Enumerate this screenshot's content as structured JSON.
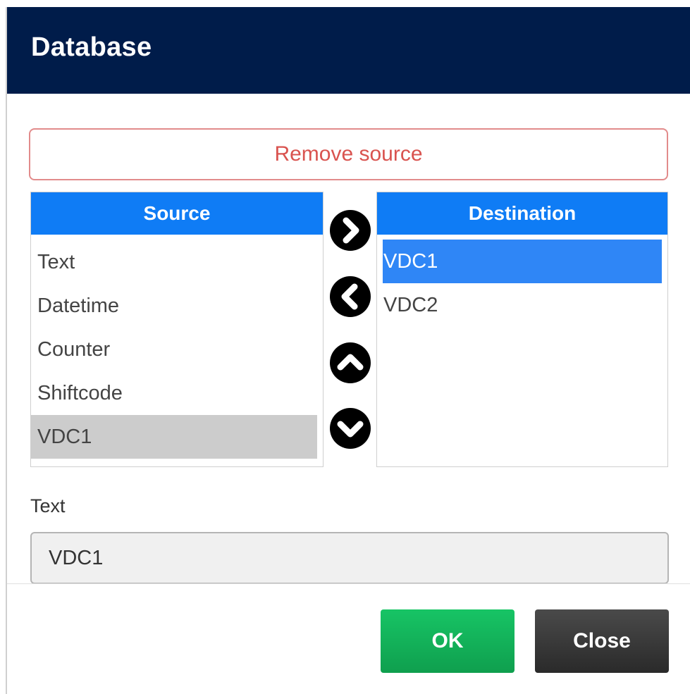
{
  "dialog": {
    "title": "Database",
    "remove_label": "Remove source",
    "source": {
      "header": "Source",
      "items": [
        "Text",
        "Datetime",
        "Counter",
        "Shiftcode",
        "VDC1"
      ],
      "selected": "VDC1"
    },
    "destination": {
      "header": "Destination",
      "items": [
        "VDC1",
        "VDC2"
      ],
      "selected": "VDC1"
    },
    "arrows": [
      "chevron-right-icon",
      "chevron-left-icon",
      "chevron-up-icon",
      "chevron-down-icon"
    ],
    "field": {
      "label": "Text",
      "value": "VDC1"
    },
    "ok_label": "OK",
    "close_label": "Close"
  },
  "colors": {
    "header_bg": "#001c4a",
    "list_header": "#0f7cf5",
    "dest_selected": "#2f86f6",
    "ok": "#15b35a",
    "close": "#333333",
    "remove_text": "#d9534f"
  }
}
